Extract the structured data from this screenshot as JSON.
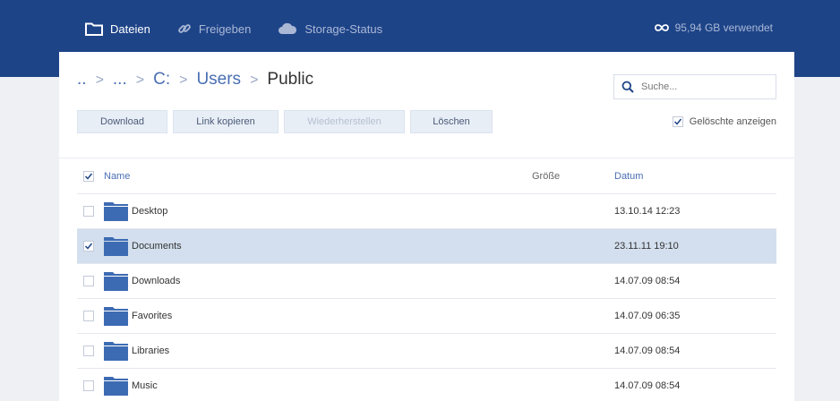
{
  "nav": {
    "items": [
      {
        "label": "Dateien",
        "icon": "folder-icon",
        "active": true
      },
      {
        "label": "Freigeben",
        "icon": "link-icon",
        "active": false
      },
      {
        "label": "Storage-Status",
        "icon": "cloud-icon",
        "active": false
      }
    ],
    "usage": "95,94 GB verwendet",
    "usage_icon": "infinity-icon"
  },
  "breadcrumb": {
    "items": [
      "..",
      "...",
      "C:",
      "Users",
      "Public"
    ],
    "separator": ">"
  },
  "search": {
    "placeholder": "Suche...",
    "value": ""
  },
  "actions": {
    "download": "Download",
    "copy_link": "Link kopieren",
    "restore": "Wiederherstellen",
    "delete": "Löschen"
  },
  "show_deleted": {
    "label": "Gelöschte anzeigen",
    "checked": true
  },
  "table": {
    "headers": {
      "name": "Name",
      "size": "Größe",
      "date": "Datum"
    },
    "rows": [
      {
        "name": "Desktop",
        "size": "",
        "date": "13.10.14 12:23",
        "checked": false
      },
      {
        "name": "Documents",
        "size": "",
        "date": "23.11.11 19:10",
        "checked": true
      },
      {
        "name": "Downloads",
        "size": "",
        "date": "14.07.09 08:54",
        "checked": false
      },
      {
        "name": "Favorites",
        "size": "",
        "date": "14.07.09 06:35",
        "checked": false
      },
      {
        "name": "Libraries",
        "size": "",
        "date": "14.07.09 08:54",
        "checked": false
      },
      {
        "name": "Music",
        "size": "",
        "date": "14.07.09 08:54",
        "checked": false
      }
    ]
  },
  "colors": {
    "header_bg": "#1e4488",
    "accent": "#4a6fb3",
    "selected_row": "#d3dfee",
    "folder": "#3d6bb3"
  }
}
